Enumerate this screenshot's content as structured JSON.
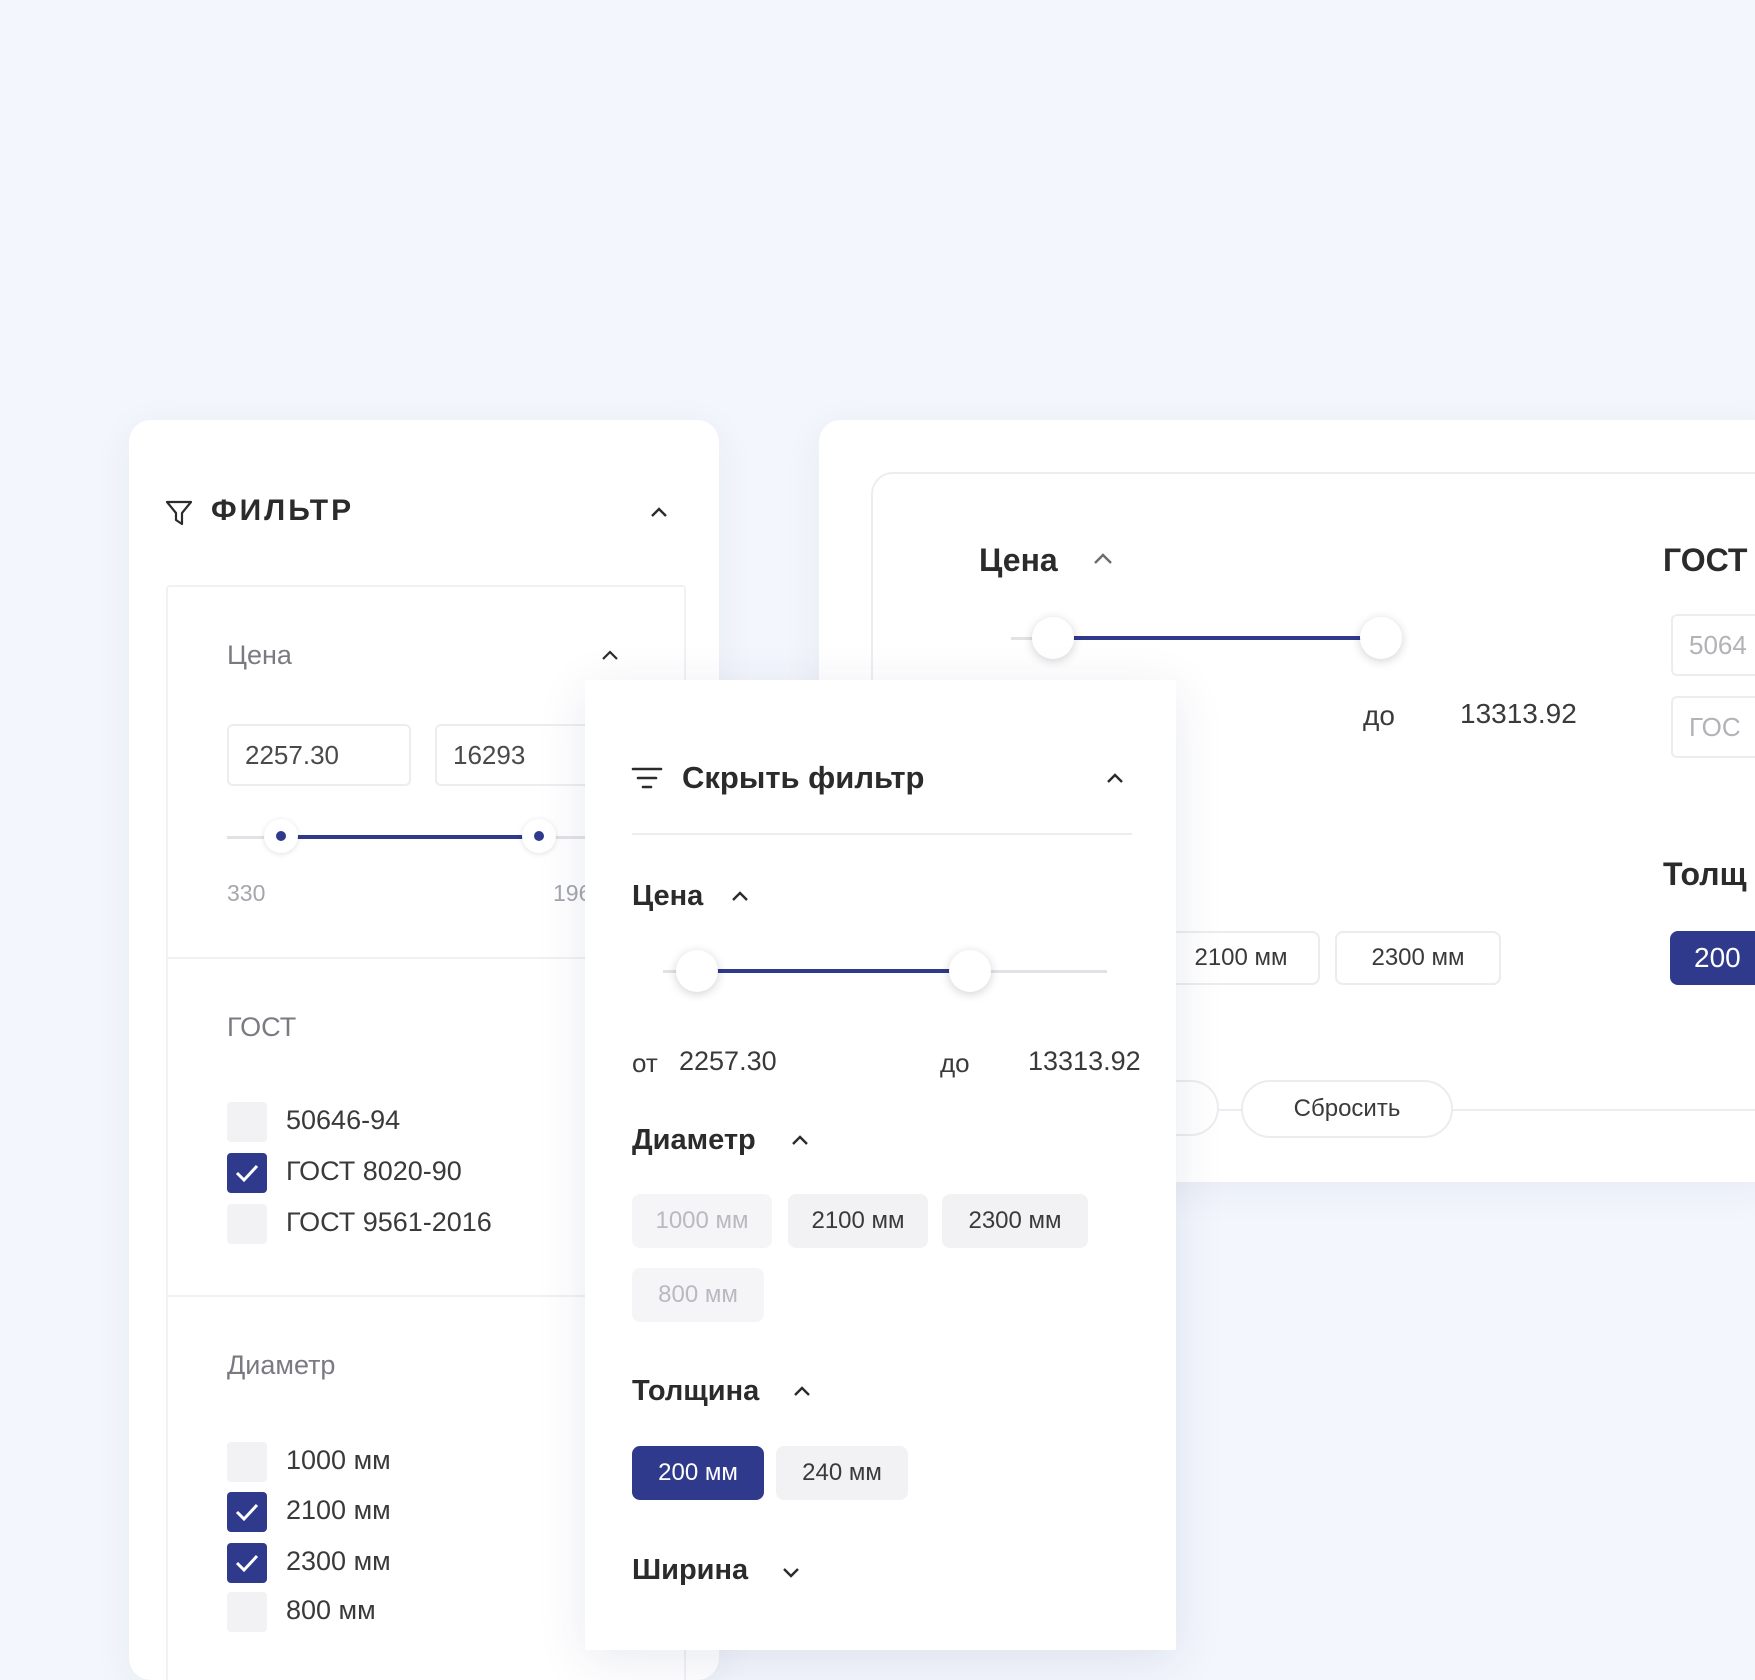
{
  "left_panel": {
    "title": "ФИЛЬТР",
    "price": {
      "label": "Цена",
      "from_value": "2257.30",
      "to_value": "16293",
      "min_label": "330",
      "max_label": "196"
    },
    "gost": {
      "label": "ГОСТ",
      "options": [
        {
          "label": "50646-94",
          "checked": false
        },
        {
          "label": "ГОСТ 8020-90",
          "checked": true
        },
        {
          "label": "ГОСТ 9561-2016",
          "checked": false
        }
      ]
    },
    "diameter": {
      "label": "Диаметр",
      "options": [
        {
          "label": "1000 мм",
          "checked": false
        },
        {
          "label": "2100 мм",
          "checked": true
        },
        {
          "label": "2300 мм",
          "checked": true
        },
        {
          "label": "800 мм",
          "checked": false
        }
      ]
    }
  },
  "right_panel": {
    "price": {
      "label": "Цена",
      "to_prefix": "до",
      "to_value": "13313.92"
    },
    "gost": {
      "label": "ГОСТ",
      "options": [
        "5064",
        "ГОС"
      ]
    },
    "diameter_chips": [
      "2100 мм",
      "2300 мм"
    ],
    "thickness": {
      "label": "Толщ",
      "active_chip": "200"
    },
    "reset_label": "Сбросить"
  },
  "popup": {
    "title": "Скрыть фильтр",
    "price": {
      "label": "Цена",
      "from_prefix": "от",
      "from_value": "2257.30",
      "to_prefix": "до",
      "to_value": "13313.92"
    },
    "diameter": {
      "label": "Диаметр",
      "chips": [
        {
          "label": "1000 мм",
          "state": "disabled"
        },
        {
          "label": "2100 мм",
          "state": "normal"
        },
        {
          "label": "2300 мм",
          "state": "normal"
        },
        {
          "label": "800 мм",
          "state": "disabled"
        }
      ]
    },
    "thickness": {
      "label": "Толщина",
      "chips": [
        {
          "label": "200 мм",
          "state": "active"
        },
        {
          "label": "240 мм",
          "state": "normal"
        }
      ]
    },
    "width": {
      "label": "Ширина"
    }
  },
  "colors": {
    "accent": "#2f3a8c",
    "background": "#f3f6fc",
    "panel": "#ffffff"
  }
}
